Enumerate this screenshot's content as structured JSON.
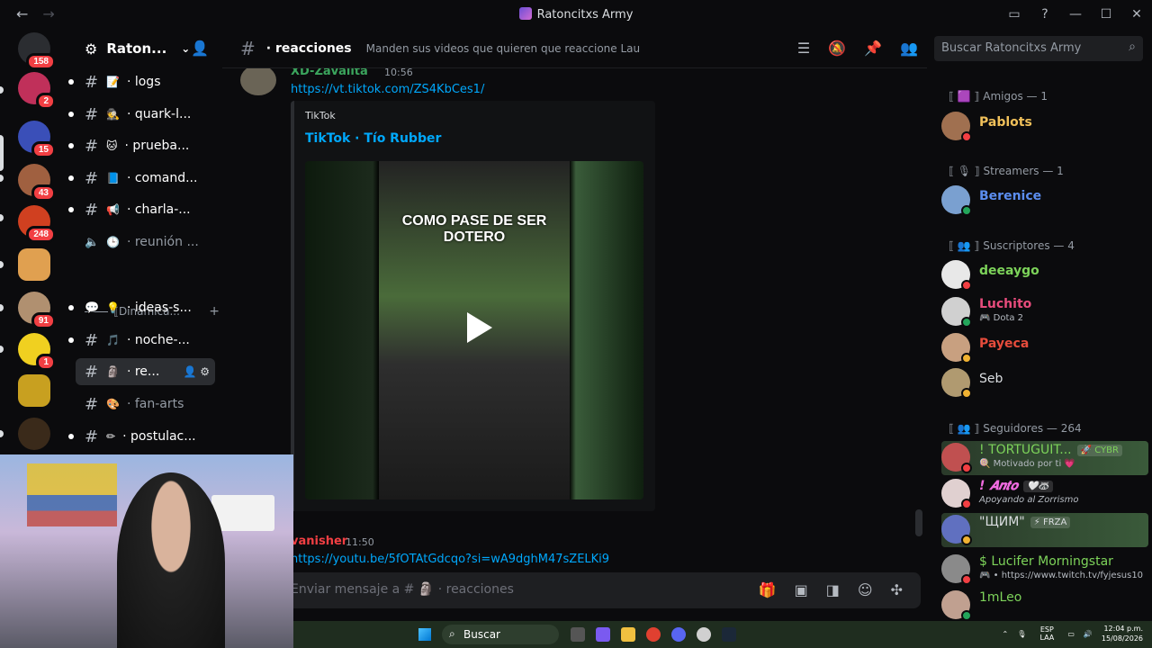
{
  "window": {
    "title": "Ratoncitxs Army"
  },
  "server": {
    "name": "Raton..."
  },
  "guild_badges": [
    "158",
    "2",
    "15",
    "43",
    "248",
    "91",
    "1"
  ],
  "channels": [
    {
      "emoji": "📝",
      "label": "· logs"
    },
    {
      "emoji": "🕵",
      "label": "· quark-l..."
    },
    {
      "emoji": "🐱",
      "label": "· prueba..."
    },
    {
      "emoji": "📘",
      "label": "· comand..."
    },
    {
      "emoji": "📢",
      "label": "· charla-..."
    },
    {
      "emoji": "🕒",
      "label": "· reunión ..."
    },
    {
      "emoji": "💡",
      "label": "· ideas-s..."
    },
    {
      "emoji": "🎵",
      "label": "· noche-..."
    },
    {
      "emoji": "🗿",
      "label": "· re..."
    },
    {
      "emoji": "🎨",
      "label": "· fan-arts"
    },
    {
      "emoji": "✏",
      "label": "· postulac..."
    }
  ],
  "category": {
    "label": "⟦Dinámica..."
  },
  "channel_header": {
    "name": "· reacciones",
    "topic": "Manden sus videos que quieren que reaccione Lau"
  },
  "search": {
    "placeholder": "Buscar Ratoncitxs Army"
  },
  "messages": {
    "first": {
      "author": "XD-Zavalita",
      "time": "10:56",
      "link": "https://vt.tiktok.com/ZS4KbCes1/",
      "embed": {
        "provider": "TikTok",
        "title": "TikTok · Tío Rubber",
        "video_caption": "COMO PASE DE SER DOTERO"
      }
    },
    "second": {
      "author": "vanisher",
      "time": "11:50",
      "link": "https://youtu.be/5fOTAtGdcqo?si=wA9dghM47sZELKi9"
    }
  },
  "composer": {
    "placeholder": "Enviar mensaje a # 🗿 · reacciones"
  },
  "members": {
    "categories": [
      {
        "label": "⟦ 🟪 ⟧ Amigos — 1"
      },
      {
        "label": "⟦ 🎙 ⟧ Streamers — 1"
      },
      {
        "label": "⟦ 👥 ⟧ Suscriptores — 4"
      },
      {
        "label": "⟦ 👥 ⟧ Seguidores — 264"
      }
    ],
    "list": [
      {
        "name": "Pablots",
        "color": "#f0c05a",
        "sub": "",
        "status": "dnd"
      },
      {
        "name": "Berenice",
        "color": "#5b8def",
        "sub": "",
        "status": "online"
      },
      {
        "name": "deeaygo",
        "color": "#7dd35a",
        "sub": "",
        "status": "dnd"
      },
      {
        "name": "Luchito",
        "color": "#e74c7c",
        "sub": "🎮 Dota 2",
        "status": "online"
      },
      {
        "name": "Payeca",
        "color": "#e74c3c",
        "sub": "",
        "status": "idle"
      },
      {
        "name": "Seb",
        "color": "#dbdee1",
        "sub": "",
        "status": "idle"
      },
      {
        "name": "! TORTUGUIT...",
        "tag": "🚀 CYBR",
        "color": "#7dd35a",
        "sub": "🍭 Motivado por ti 💗",
        "status": "dnd"
      },
      {
        "name": "! 𝑨𝒏𝒕𝒐",
        "tag": "🤍🦝",
        "color": "#f06be0",
        "sub": "Apoyando al Zorrismo",
        "status": "dnd"
      },
      {
        "name": "\"ЩИМ\"",
        "tag": "⚡ FRZA",
        "color": "#dbdee1",
        "sub": "",
        "status": "idle"
      },
      {
        "name": "$ Lucifer Morningstar",
        "color": "#7dd35a",
        "sub": "🎮 • https://www.twitch.tv/fyjesus10",
        "status": "dnd"
      },
      {
        "name": "1mLeo",
        "color": "#7dd35a",
        "sub": "",
        "status": "online"
      }
    ]
  },
  "taskbar": {
    "search": "Buscar",
    "lang": "ESP LAA",
    "time": "12:04 p.m.",
    "date": "15/08/2026"
  },
  "colors": {
    "accent": "#00a8fc",
    "online": "#23a55a",
    "dnd": "#f23f43",
    "idle": "#f0b232"
  }
}
